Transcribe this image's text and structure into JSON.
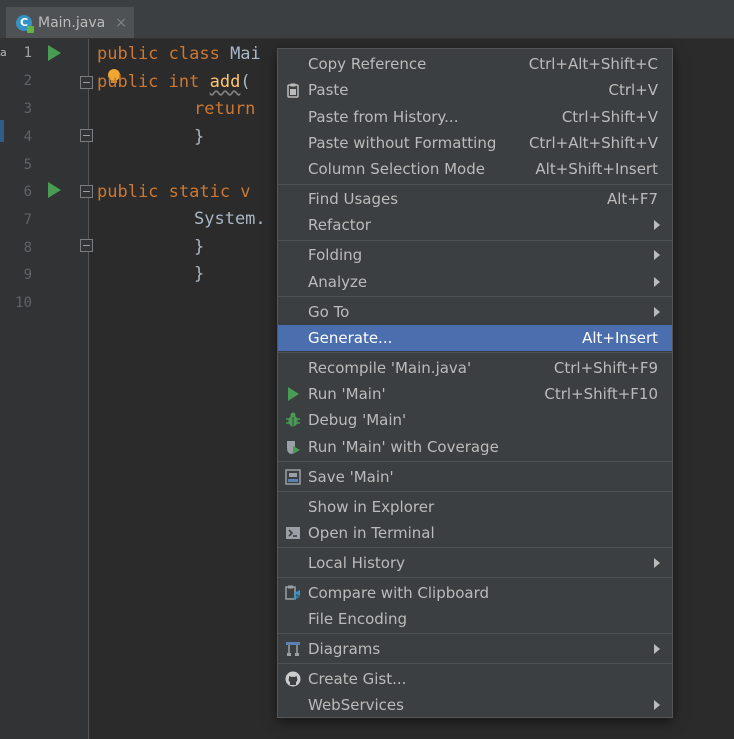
{
  "tab": {
    "title": "Main.java",
    "close": "×",
    "icon_letter": "C"
  },
  "gutter": {
    "left_marker": "a",
    "line_numbers": [
      "1",
      "2",
      "3",
      "4",
      "5",
      "6",
      "7",
      "8",
      "9",
      "10"
    ]
  },
  "code": {
    "l1_kw": "public class ",
    "l1_name": "Mai",
    "l2_kw": "public int ",
    "l2_fn": "add",
    "l2_paren": "(",
    "l3_kw": "return",
    "l4": "}",
    "l6_kw": "public static v",
    "l7": "System.",
    "l8": "}",
    "l9": "}"
  },
  "menu": {
    "copy_reference": {
      "label": "Copy Reference",
      "shortcut": "Ctrl+Alt+Shift+C"
    },
    "paste": {
      "label": "Paste",
      "shortcut": "Ctrl+V"
    },
    "paste_history": {
      "label": "Paste from History...",
      "shortcut": "Ctrl+Shift+V"
    },
    "paste_no_format": {
      "label": "Paste without Formatting",
      "shortcut": "Ctrl+Alt+Shift+V"
    },
    "column_selection": {
      "label": "Column Selection Mode",
      "shortcut": "Alt+Shift+Insert"
    },
    "find_usages": {
      "label": "Find Usages",
      "shortcut": "Alt+F7"
    },
    "refactor": {
      "label": "Refactor"
    },
    "folding": {
      "label": "Folding"
    },
    "analyze": {
      "label": "Analyze"
    },
    "goto": {
      "label": "Go To"
    },
    "generate": {
      "label": "Generate...",
      "shortcut": "Alt+Insert"
    },
    "recompile": {
      "label": "Recompile 'Main.java'",
      "shortcut": "Ctrl+Shift+F9"
    },
    "run": {
      "label": "Run 'Main'",
      "shortcut": "Ctrl+Shift+F10"
    },
    "debug": {
      "label": "Debug 'Main'"
    },
    "coverage": {
      "label": "Run 'Main' with Coverage"
    },
    "save": {
      "label": "Save 'Main'"
    },
    "show_explorer": {
      "label": "Show in Explorer"
    },
    "open_terminal": {
      "label": "Open in Terminal"
    },
    "local_history": {
      "label": "Local History"
    },
    "compare_clipboard": {
      "label": "Compare with Clipboard"
    },
    "file_encoding": {
      "label": "File Encoding"
    },
    "diagrams": {
      "label": "Diagrams"
    },
    "create_gist": {
      "label": "Create Gist..."
    },
    "webservices": {
      "label": "WebServices"
    }
  },
  "colors": {
    "selection": "#4b6eaf",
    "run_green": "#499c54",
    "keyword": "#cc7832",
    "function": "#ffc66d"
  },
  "icons": [
    "file-java-icon",
    "run-icon",
    "fold-icon",
    "bulb-icon",
    "paste-icon",
    "run-icon",
    "debug-icon",
    "coverage-icon",
    "save-icon",
    "terminal-icon",
    "compare-icon",
    "diagram-icon",
    "github-icon",
    "submenu-arrow-icon"
  ]
}
